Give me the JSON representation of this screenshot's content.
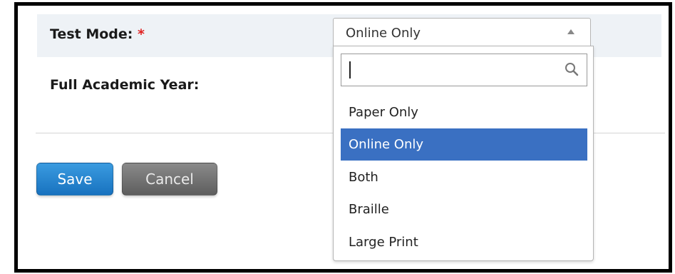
{
  "form": {
    "test_mode_label": "Test Mode:",
    "required_mark": "*",
    "full_academic_year_label": "Full Academic Year:"
  },
  "test_mode_select": {
    "value": "Online Only",
    "search_value": "",
    "options": [
      {
        "label": "Paper Only",
        "selected": false
      },
      {
        "label": "Online Only",
        "selected": true
      },
      {
        "label": "Both",
        "selected": false
      },
      {
        "label": "Braille",
        "selected": false
      },
      {
        "label": "Large Print",
        "selected": false
      }
    ]
  },
  "buttons": {
    "save": "Save",
    "cancel": "Cancel"
  },
  "colors": {
    "required": "#e02020",
    "selected_option": "#3a70c2",
    "save_button": "#1f80cc",
    "cancel_button": "#6e6e6e"
  }
}
